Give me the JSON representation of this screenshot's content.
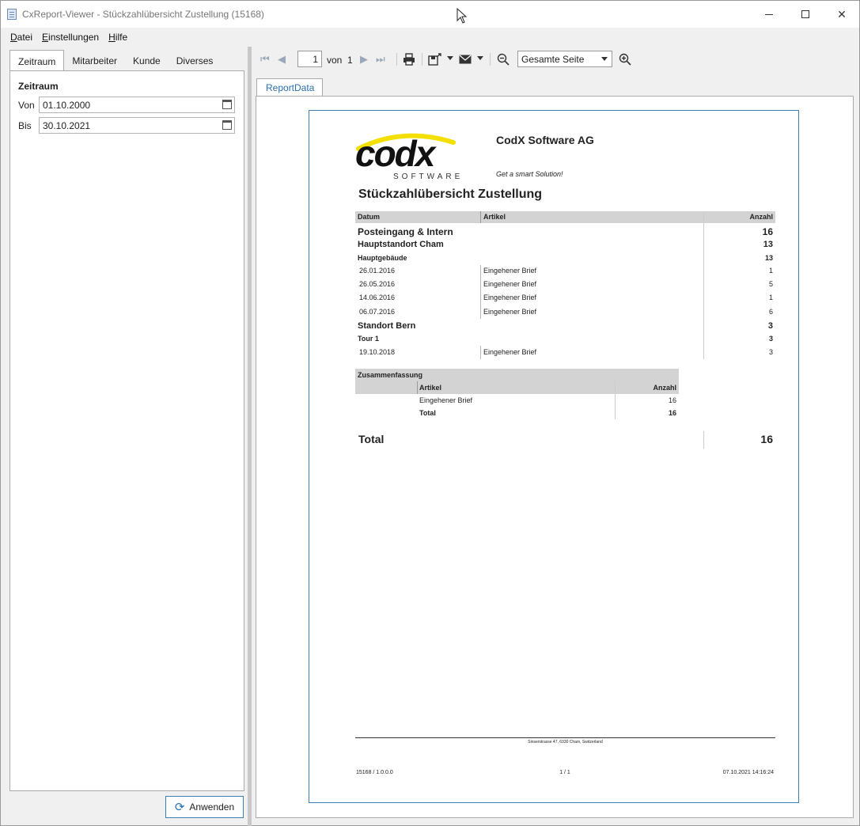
{
  "window": {
    "title": "CxReport-Viewer - Stückzahlübersicht Zustellung (15168)"
  },
  "menu": [
    {
      "label": "Datei",
      "u": "D",
      "rest": "atei"
    },
    {
      "label": "Einstellungen",
      "u": "E",
      "rest": "instellungen"
    },
    {
      "label": "Hilfe",
      "u": "H",
      "rest": "ilfe"
    }
  ],
  "left_tabs": [
    "Zeitraum",
    "Mitarbeiter",
    "Kunde",
    "Diverses"
  ],
  "filter": {
    "section_title": "Zeitraum",
    "von_label": "Von",
    "von_value": "01.10.2000",
    "bis_label": "Bis",
    "bis_value": "30.10.2021"
  },
  "apply_label": "Anwenden",
  "toolbar": {
    "page_value": "1",
    "of_label": "von",
    "page_total": "1",
    "zoom_value": "Gesamte Seite"
  },
  "viewer_tab": "ReportData",
  "report": {
    "logo_text": "codx",
    "logo_sub": "SOFTWARE",
    "company": "CodX Software AG",
    "slogan": "Get a smart Solution!",
    "title": "Stückzahlübersicht Zustellung",
    "col_datum": "Datum",
    "col_artikel": "Artikel",
    "col_anzahl": "Anzahl",
    "g1": {
      "label": "Posteingang & Intern",
      "value": "16"
    },
    "g2a": {
      "label": "Hauptstandort Cham",
      "value": "13"
    },
    "g3a": {
      "label": "Hauptgebäude",
      "value": "13"
    },
    "rows_a": [
      {
        "date": "26.01.2016",
        "article": "Eingehener Brief",
        "count": "1"
      },
      {
        "date": "26.05.2016",
        "article": "Eingehener Brief",
        "count": "5"
      },
      {
        "date": "14.06.2016",
        "article": "Eingehener Brief",
        "count": "1"
      },
      {
        "date": "06.07.2016",
        "article": "Eingehener Brief",
        "count": "6"
      }
    ],
    "g2b": {
      "label": "Standort Bern",
      "value": "3"
    },
    "g3b": {
      "label": "Tour 1",
      "value": "3"
    },
    "rows_b": [
      {
        "date": "19.10.2018",
        "article": "Eingehener Brief",
        "count": "3"
      }
    ],
    "summary": {
      "title": "Zusammenfassung",
      "col_artikel": "Artikel",
      "col_anzahl": "Anzahl",
      "item": "Eingehener Brief",
      "item_value": "16",
      "total_label": "Total",
      "total_value": "16"
    },
    "grand_total_label": "Total",
    "grand_total_value": "16",
    "footer_address": "Sinserstrasse 47, 6330 Cham, Switzerland",
    "footer_left": "15168 / 1.0.0.0",
    "footer_center": "1 / 1",
    "footer_right": "07.10.2021 14:16:24"
  }
}
